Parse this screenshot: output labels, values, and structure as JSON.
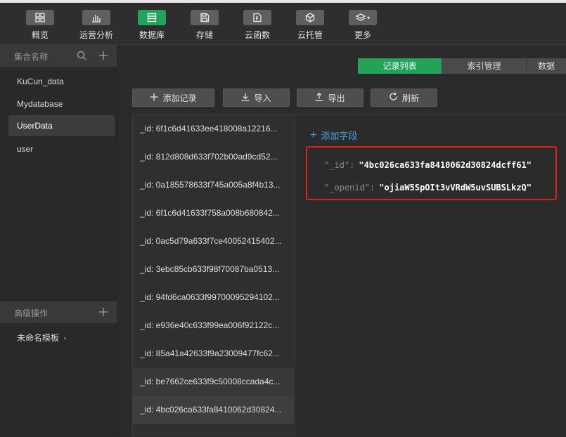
{
  "toolbar": {
    "items": [
      {
        "label": "概览",
        "icon": "grid-icon"
      },
      {
        "label": "运营分析",
        "icon": "bar-chart-icon"
      },
      {
        "label": "数据库",
        "icon": "database-icon",
        "active": true
      },
      {
        "label": "存储",
        "icon": "save-icon"
      },
      {
        "label": "云函数",
        "icon": "function-icon"
      },
      {
        "label": "云托管",
        "icon": "cube-icon"
      },
      {
        "label": "更多",
        "icon": "layers-icon"
      }
    ]
  },
  "sidebar": {
    "collections_header": "集合名称",
    "collections": [
      "KuCun_data",
      "Mydatabase",
      "UserData",
      "user"
    ],
    "selected_collection": "UserData",
    "advanced_header": "高级操作",
    "templates": [
      "未命名模板"
    ]
  },
  "tabs": [
    "记录列表",
    "索引管理",
    "数据"
  ],
  "actions": {
    "add_record": "添加记录",
    "import": "导入",
    "export": "导出",
    "refresh": "刷新"
  },
  "records": [
    "_id: 6f1c6d41633ee418008a12216...",
    "_id: 812d808d633f702b00ad9cd52...",
    "_id: 0a185578633f745a005a8f4b13...",
    "_id: 6f1c6d41633f758a008b680842...",
    "_id: 0ac5d79a633f7ce40052415402...",
    "_id: 3ebc85cb633f98f70087ba0513...",
    "_id: 94fd6ca0633f99700095294102...",
    "_id: e936e40c633f99ea006f92122c...",
    "_id: 85a41a42633f9a23009477fc62...",
    "_id: be7662ce633f9c50008ccada4c...",
    "_id: 4bc026ca633fa8410062d30824..."
  ],
  "detail": {
    "add_field": "添加字段",
    "fields": [
      {
        "key": "\"_id\"",
        "value": "\"4bc026ca633fa8410062d30824dcff61\""
      },
      {
        "key": "\"_openid\"",
        "value": "\"ojiaW5SpOIt3vVRdW5uvSUBSLkzQ\""
      }
    ]
  },
  "colors": {
    "accent": "#23a35a",
    "highlight_border": "#e0201d",
    "link": "#4a9fe0"
  }
}
